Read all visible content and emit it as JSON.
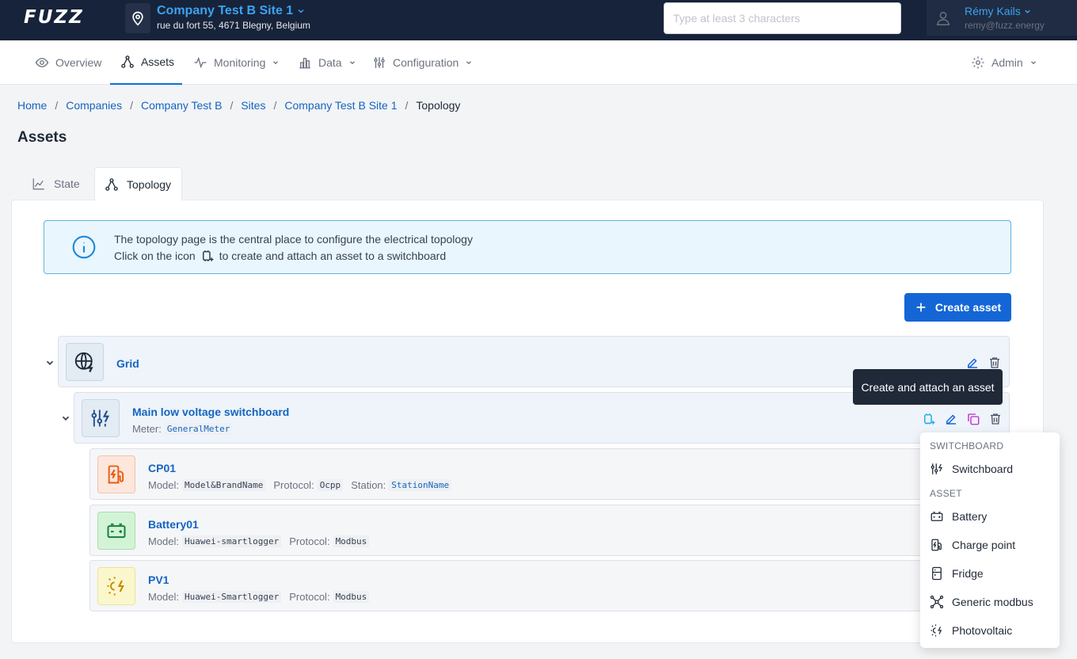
{
  "topbar": {
    "logo_text": "FUZZ",
    "site_name": "Company Test B Site 1",
    "site_address": "rue du fort 55, 4671 Blegny, Belgium",
    "search_placeholder": "Type at least 3 characters",
    "user_name": "Rémy Kails",
    "user_email": "remy@fuzz.energy"
  },
  "nav": {
    "overview": "Overview",
    "assets": "Assets",
    "monitoring": "Monitoring",
    "data": "Data",
    "configuration": "Configuration",
    "admin": "Admin"
  },
  "breadcrumb": {
    "items": [
      "Home",
      "Companies",
      "Company Test B",
      "Sites",
      "Company Test B Site 1"
    ],
    "current": "Topology"
  },
  "page_title": "Assets",
  "tabs": {
    "state": "State",
    "topology": "Topology"
  },
  "info": {
    "line1": "The topology page is the central place to configure the electrical topology",
    "line2_before": "Click on the icon",
    "line2_after": "to create and attach an asset to a switchboard"
  },
  "create_button": "Create asset",
  "tree": {
    "grid": {
      "title": "Grid"
    },
    "switchboard": {
      "title": "Main low voltage switchboard",
      "meter_label": "Meter:",
      "meter_value": "GeneralMeter"
    },
    "assets": [
      {
        "title": "CP01",
        "model_label": "Model:",
        "model": "Model&BrandName",
        "protocol_label": "Protocol:",
        "protocol": "Ocpp",
        "station_label": "Station:",
        "station": "StationName"
      },
      {
        "title": "Battery01",
        "model_label": "Model:",
        "model": "Huawei-smartlogger",
        "protocol_label": "Protocol:",
        "protocol": "Modbus"
      },
      {
        "title": "PV1",
        "model_label": "Model:",
        "model": "Huawei-Smartlogger",
        "protocol_label": "Protocol:",
        "protocol": "Modbus"
      }
    ]
  },
  "tooltip": "Create and attach an asset",
  "menu": {
    "switchboard_header": "SWITCHBOARD",
    "switchboard_item": "Switchboard",
    "asset_header": "ASSET",
    "items": [
      "Battery",
      "Charge point",
      "Fridge",
      "Generic modbus",
      "Photovoltaic"
    ]
  },
  "colors": {
    "topbar_bg": "#17233a",
    "accent": "#1466d6",
    "link": "#1565c0",
    "charge_point": "#ea580c",
    "battery": "#15803d",
    "pv": "#ca8a04",
    "duplicate": "#c026d3",
    "attach": "#0ea5e9"
  }
}
